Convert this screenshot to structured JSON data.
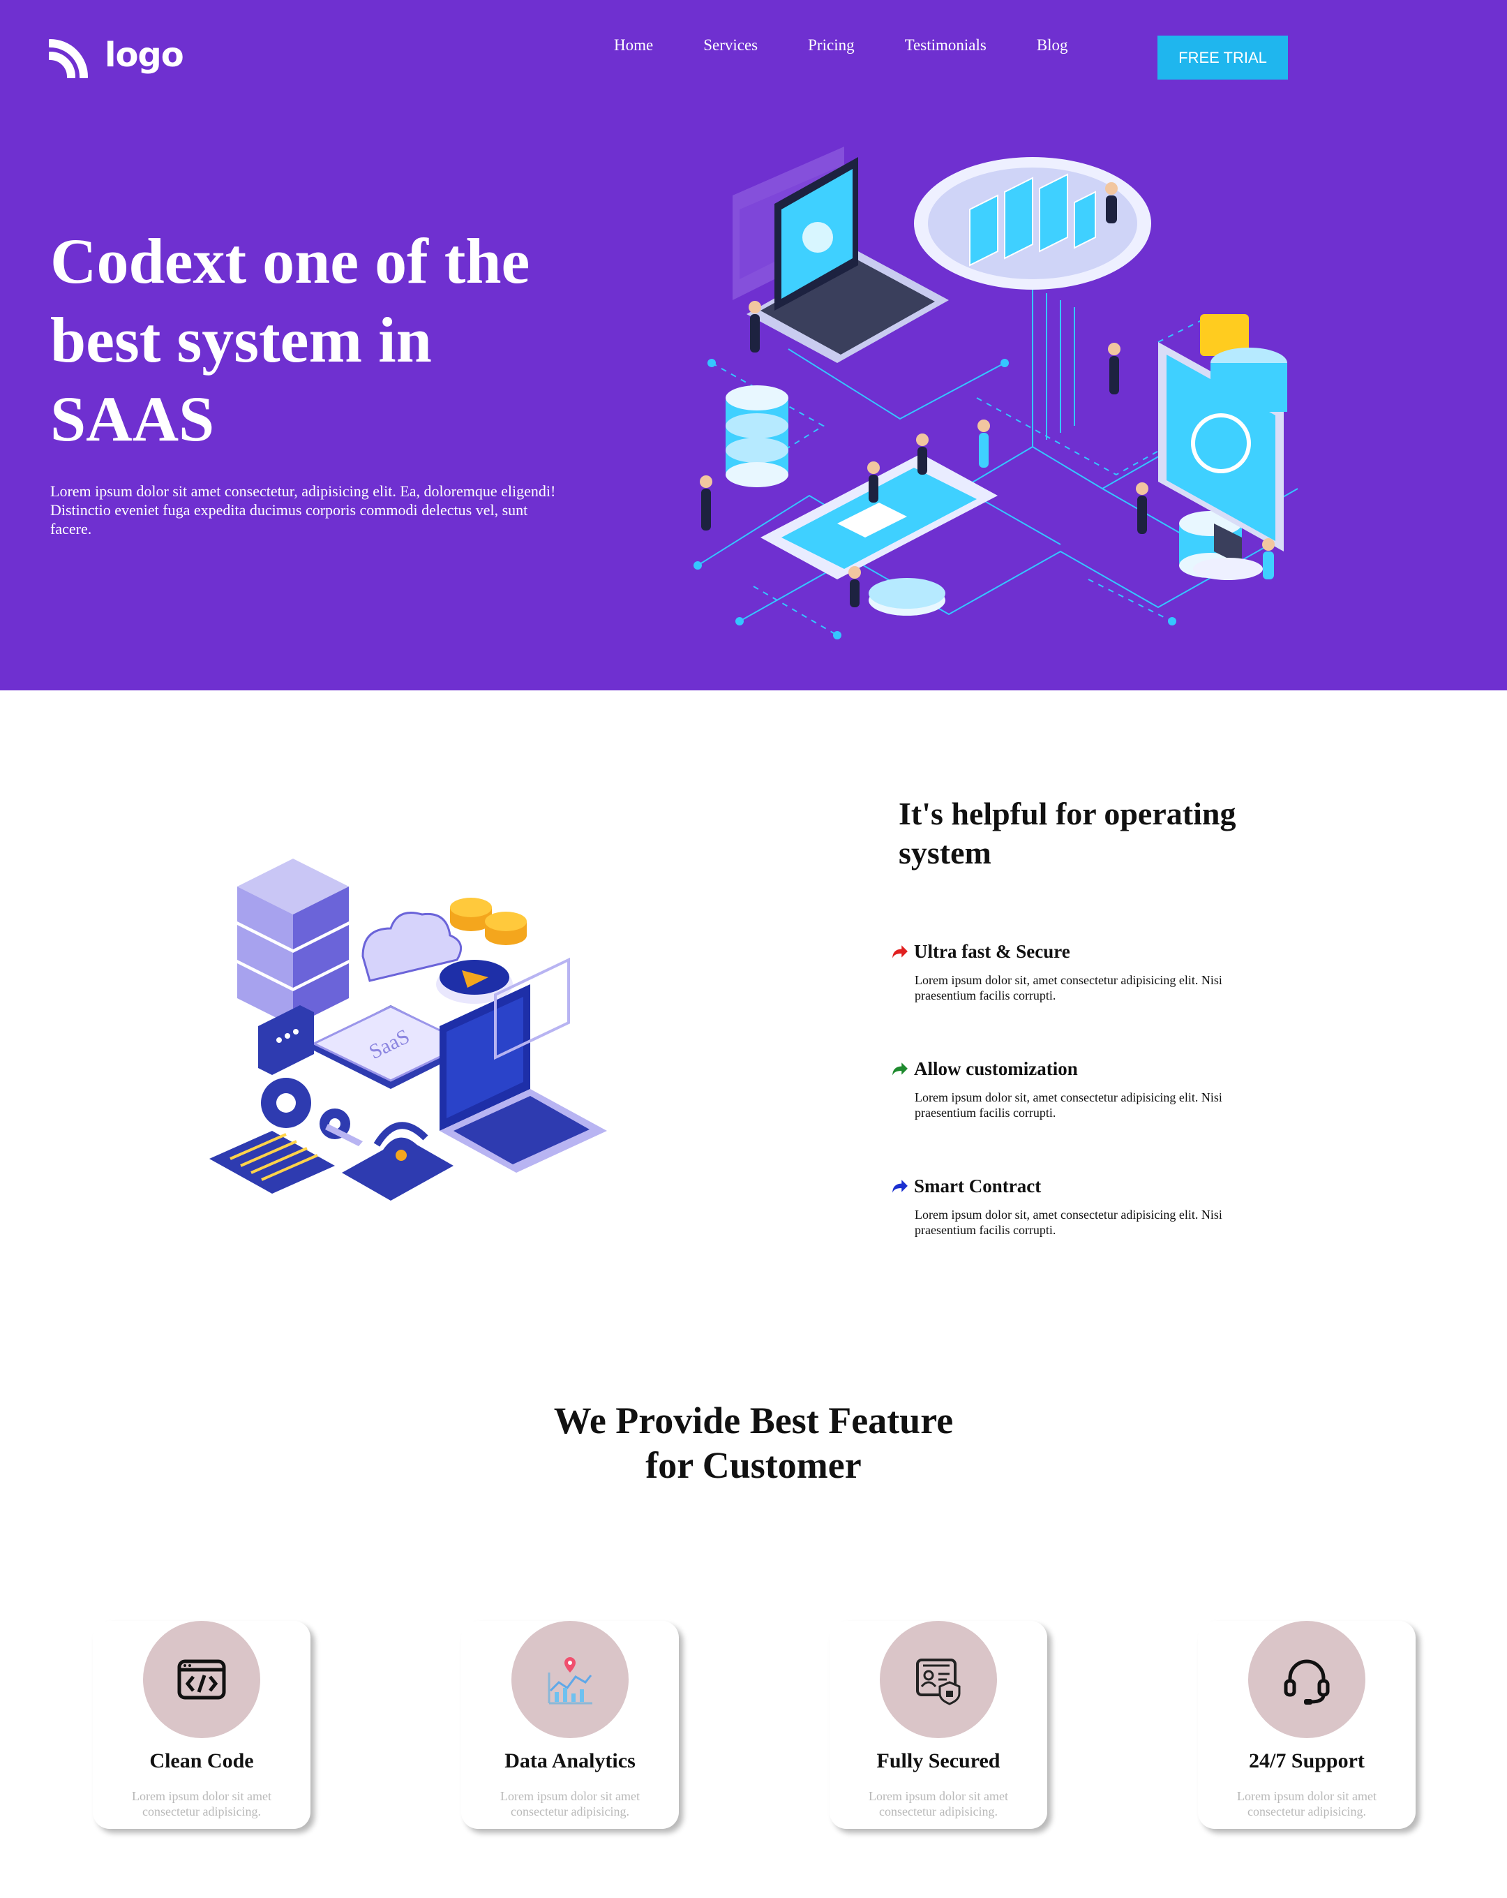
{
  "brand": {
    "logo_text": "logo"
  },
  "nav": {
    "items": [
      {
        "label": "Home"
      },
      {
        "label": "Services"
      },
      {
        "label": "Pricing"
      },
      {
        "label": "Testimonials"
      },
      {
        "label": "Blog"
      }
    ],
    "cta_label": "FREE TRIAL"
  },
  "hero": {
    "title_line1": "Codext one of the",
    "title_line2": "best system in",
    "title_line3": "SAAS",
    "subtitle": "Lorem ipsum dolor sit amet consectetur, adipisicing elit. Ea, doloremque eligendi! Distinctio eveniet fuga expedita ducimus corporis commodi delectus vel, sunt facere."
  },
  "feature_block": {
    "title_line1": "It's helpful for operating",
    "title_line2": "system",
    "illustration_label": "SaaS",
    "items": [
      {
        "name": "Ultra fast & Secure",
        "desc_line1": "Lorem ipsum dolor sit, amet consectetur adipisicing elit. Nisi",
        "desc_line2": "praesentium facilis corrupti.",
        "color": "#e02020"
      },
      {
        "name": "Allow customization",
        "desc_line1": "Lorem ipsum dolor sit, amet consectetur adipisicing elit. Nisi",
        "desc_line2": "praesentium facilis corrupti.",
        "color": "#1e8a2e"
      },
      {
        "name": "Smart Contract",
        "desc_line1": "Lorem ipsum dolor sit, amet consectetur adipisicing elit. Nisi",
        "desc_line2": "praesentium facilis corrupti.",
        "color": "#1a2fd0"
      }
    ]
  },
  "features": {
    "title_line1": "We Provide Best Feature",
    "title_line2": "for Customer",
    "cards": [
      {
        "icon": "code-icon",
        "title": "Clean Code",
        "desc_line1": "Lorem ipsum dolor sit amet",
        "desc_line2": "consectetur adipisicing."
      },
      {
        "icon": "analytics-icon",
        "title": "Data Analytics",
        "desc_line1": "Lorem ipsum dolor sit amet",
        "desc_line2": "consectetur adipisicing."
      },
      {
        "icon": "security-icon",
        "title": "Fully Secured",
        "desc_line1": "Lorem ipsum dolor sit amet",
        "desc_line2": "consectetur adipisicing."
      },
      {
        "icon": "headset-icon",
        "title": "24/7 Support",
        "desc_line1": "Lorem ipsum dolor sit amet",
        "desc_line2": "consectetur adipisicing."
      }
    ]
  },
  "colors": {
    "hero_bg": "#6f30d0",
    "cta_bg": "#1fb6ee",
    "icon_circle": "#dac5c8",
    "muted_text": "#b9b9b9"
  }
}
